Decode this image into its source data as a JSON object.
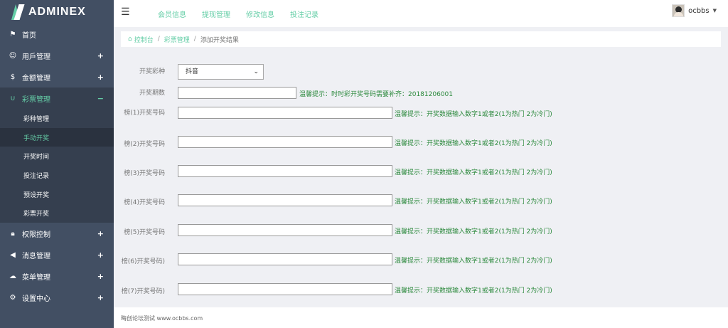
{
  "brand": {
    "name": "ADMINEX"
  },
  "sidebar": {
    "items": [
      {
        "label": "首页",
        "icon": "flag-icon",
        "expandable": false
      },
      {
        "label": "用戶管理",
        "icon": "smile-icon",
        "expandable": true
      },
      {
        "label": "金额管理",
        "icon": "dollar-icon",
        "expandable": true
      },
      {
        "label": "彩票管理",
        "icon": "magnet-icon",
        "expandable": true,
        "active": true,
        "children": [
          "彩种管理",
          "手动开奖",
          "开奖时间",
          "投注记录",
          "预设开奖",
          "彩票开奖"
        ],
        "active_child": 1
      },
      {
        "label": "权限控制",
        "icon": "lock-icon",
        "expandable": true
      },
      {
        "label": "消息管理",
        "icon": "bullhorn-icon",
        "expandable": true
      },
      {
        "label": "菜单管理",
        "icon": "cloud-icon",
        "expandable": true
      },
      {
        "label": "设置中心",
        "icon": "gear-icon",
        "expandable": true
      }
    ]
  },
  "header": {
    "nav": [
      "会员信息",
      "提现管理",
      "修改信息",
      "投注记录"
    ],
    "user": {
      "name": "ocbbs"
    }
  },
  "breadcrumb": {
    "home": "控制台",
    "parent": "彩票管理",
    "current": "添加开奖结果"
  },
  "form": {
    "type_label": "开奖彩种",
    "type_value": "抖音",
    "period_label": "开奖期数",
    "period_hint": "温馨提示：时时彩开奖号码需要补齐：20181206001",
    "numbers": [
      {
        "label": "榜(1)开奖号码",
        "hint": "温馨提示：开奖数据输入数字1或者2(1为热门 2为冷门)"
      },
      {
        "label": "榜(2)开奖号码",
        "hint": "温馨提示：开奖数据输入数字1或者2(1为热门 2为冷门)"
      },
      {
        "label": "榜(3)开奖号码",
        "hint": "温馨提示：开奖数据输入数字1或者2(1为热门 2为冷门)"
      },
      {
        "label": "榜(4)开奖号码",
        "hint": "温馨提示：开奖数据输入数字1或者2(1为热门 2为冷门)"
      },
      {
        "label": "榜(5)开奖号码",
        "hint": "温馨提示：开奖数据输入数字1或者2(1为热门 2为冷门)"
      },
      {
        "label": "榜(6)开奖号码)",
        "hint": "温馨提示：开奖数据输入数字1或者2(1为热门 2为冷门)"
      },
      {
        "label": "榜(7)开奖号码)",
        "hint": "温馨提示：开奖数据输入数字1或者2(1为热门 2为冷门)"
      }
    ]
  },
  "footer": {
    "text": "晦创论坛测试 www.ocbbs.com"
  },
  "colors": {
    "sidebar": "#424f63",
    "accent": "#65cea7",
    "hint": "#2d8a3e"
  }
}
